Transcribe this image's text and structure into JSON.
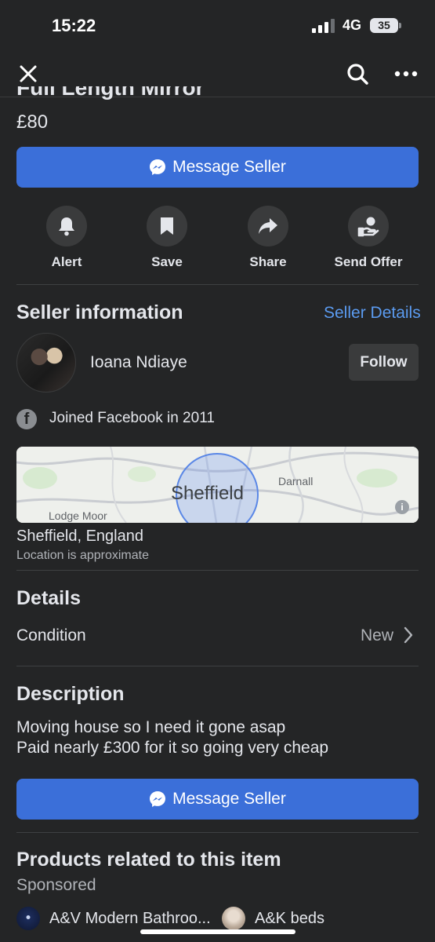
{
  "status_bar": {
    "time": "15:22",
    "network": "4G",
    "battery": "35"
  },
  "nav": {
    "close_icon": "close-icon",
    "search_icon": "search-icon",
    "more_icon": "more-icon"
  },
  "listing": {
    "title": "Full Length Mirror",
    "price": "£80",
    "message_button": "Message Seller"
  },
  "actions": [
    {
      "label": "Alert",
      "icon": "bell-icon"
    },
    {
      "label": "Save",
      "icon": "bookmark-icon"
    },
    {
      "label": "Share",
      "icon": "share-icon"
    },
    {
      "label": "Send Offer",
      "icon": "offer-icon"
    }
  ],
  "seller": {
    "section_title": "Seller information",
    "details_link": "Seller Details",
    "name": "Ioana Ndiaye",
    "follow_label": "Follow",
    "joined": "Joined Facebook in 2011"
  },
  "map": {
    "city_label": "Sheffield",
    "place_1": "Darnall",
    "place_2": "Lodge Moor",
    "info": "i"
  },
  "location": {
    "name": "Sheffield, England",
    "note": "Location is approximate"
  },
  "details": {
    "section_title": "Details",
    "condition_label": "Condition",
    "condition_value": "New"
  },
  "description": {
    "section_title": "Description",
    "line_1": "Moving house so I need it gone asap",
    "line_2": "Paid nearly £300 for it so going very cheap",
    "message_button": "Message Seller"
  },
  "related": {
    "section_title": "Products related to this item",
    "sponsored": "Sponsored",
    "items": [
      {
        "name": "A&V Modern Bathroo..."
      },
      {
        "name": "A&K beds"
      }
    ]
  },
  "colors": {
    "background": "#242526",
    "primary_button": "#3b6fd9",
    "link": "#5b9bf0"
  }
}
